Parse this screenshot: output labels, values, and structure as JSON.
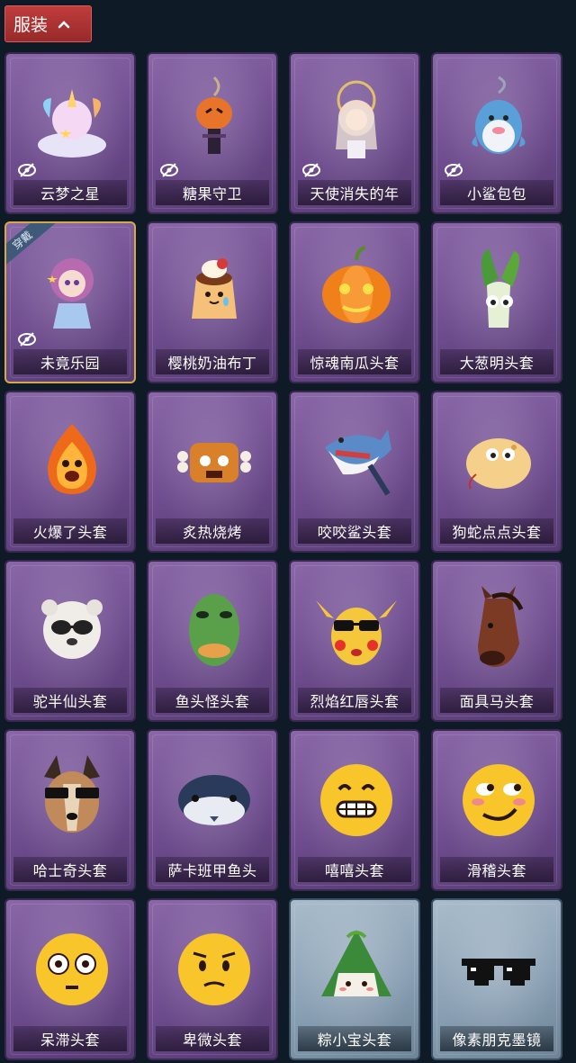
{
  "header": {
    "label": "服装"
  },
  "items": [
    {
      "name": "云梦之星",
      "icon": "unicorn-icon",
      "hidden": true
    },
    {
      "name": "糖果守卫",
      "icon": "pumpkin-charm-icon",
      "hidden": true
    },
    {
      "name": "天使消失的年",
      "icon": "angel-doll-icon",
      "hidden": true
    },
    {
      "name": "小鲨包包",
      "icon": "shark-bag-icon",
      "hidden": true
    },
    {
      "name": "未竟乐园",
      "icon": "doll-icon",
      "hidden": true,
      "badge": "穿戴"
    },
    {
      "name": "樱桃奶油布丁",
      "icon": "pudding-icon"
    },
    {
      "name": "惊魂南瓜头套",
      "icon": "pumpkin-icon"
    },
    {
      "name": "大葱明头套",
      "icon": "scallion-icon"
    },
    {
      "name": "火爆了头套",
      "icon": "fire-icon"
    },
    {
      "name": "炙热烧烤",
      "icon": "sausage-icon"
    },
    {
      "name": "咬咬鲨头套",
      "icon": "shark-icon"
    },
    {
      "name": "狗蛇点点头套",
      "icon": "snake-icon"
    },
    {
      "name": "驼半仙头套",
      "icon": "bear-icon"
    },
    {
      "name": "鱼头怪头套",
      "icon": "fish-head-icon"
    },
    {
      "name": "烈焰红唇头套",
      "icon": "pikachu-icon"
    },
    {
      "name": "面具马头套",
      "icon": "horse-icon"
    },
    {
      "name": "哈士奇头套",
      "icon": "husky-icon"
    },
    {
      "name": "萨卡班甲鱼头",
      "icon": "fish-icon"
    },
    {
      "name": "嘻嘻头套",
      "icon": "grin-emoji-icon"
    },
    {
      "name": "滑稽头套",
      "icon": "funny-emoji-icon"
    },
    {
      "name": "呆滞头套",
      "icon": "stare-emoji-icon"
    },
    {
      "name": "卑微头套",
      "icon": "humble-emoji-icon"
    },
    {
      "name": "粽小宝头套",
      "icon": "zongzi-icon",
      "tint": "blue"
    },
    {
      "name": "像素朋克墨镜",
      "icon": "pixel-sunglasses-icon",
      "tint": "blue"
    }
  ],
  "colors": {
    "header": "#a83232",
    "card_purple": "#7a5a9a",
    "card_blue": "#93a9bc",
    "background": "#0e1a26",
    "equipped_border": "#d6a84a"
  }
}
